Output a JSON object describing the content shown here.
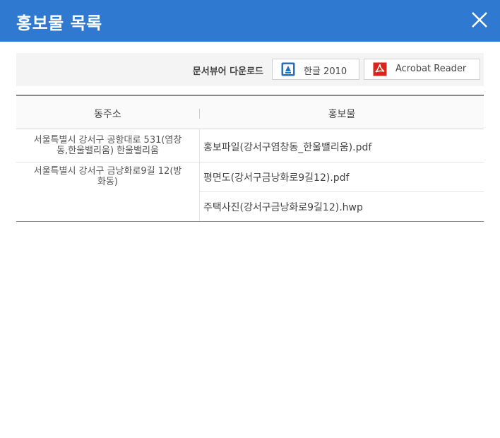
{
  "dialog": {
    "title": "홍보물 목록",
    "close_icon": "close-icon"
  },
  "viewer_bar": {
    "label": "문서뷰어 다운로드",
    "buttons": [
      {
        "label": "한글 2010",
        "icon": "hwp-icon"
      },
      {
        "label": "Acrobat Reader",
        "icon": "pdf-icon"
      }
    ]
  },
  "table": {
    "headers": [
      "동주소",
      "홍보물"
    ],
    "addresses": [
      {
        "line1": "서울특별시 강서구 공항대로 531(염창",
        "line2": "동,한울밸리움) 한울밸리움"
      },
      {
        "line1": "서울특별시 강서구 금낭화로9길 12(방",
        "line2": "화동)"
      }
    ],
    "files": [
      "홍보파일(강서구염창동_한울밸리움).pdf",
      "평면도(강서구금낭화로9길12).pdf",
      "주택사진(강서구금낭화로9길12).hwp"
    ]
  },
  "colors": {
    "header_bg": "#2f79d0",
    "pdf_red": "#d8261c",
    "hwp_blue": "#2a6fbe"
  }
}
